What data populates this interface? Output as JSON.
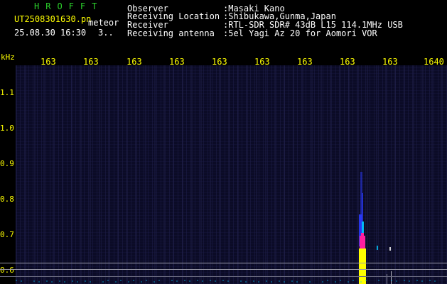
{
  "header": {
    "code": "HROFFT",
    "filename": "UT2508301630.pn",
    "type": "meteor",
    "timestamp": "25.08.30 16:30",
    "count": "3.."
  },
  "info": [
    {
      "label": "Observer",
      "value": ":Masaki Kano"
    },
    {
      "label": "Receiving Location",
      "value": ":Shibukawa,Gunma,Japan"
    },
    {
      "label": "Receiver",
      "value": ":RTL-SDR SDR# 43dB L15 114.1MHz USB"
    },
    {
      "label": "Receiving antenna",
      "value": ":5el Yagi Az 20 for Aomori VOR"
    }
  ],
  "axes": {
    "y_unit": "kHz",
    "x_ticks": [
      "163",
      "163",
      "163",
      "163",
      "163",
      "163",
      "163",
      "163",
      "163",
      "1640"
    ],
    "y_ticks": [
      "1.1",
      "1.0",
      "0.9",
      "0.8",
      "0.7",
      "0.6"
    ]
  },
  "colors": {
    "background": "#000000",
    "plot_noise": "#0b0b26",
    "text_yellow": "#ffff00",
    "text_green": "#2bd12b",
    "echo_yellow": "#ffff00",
    "echo_magenta": "#ff1fa0",
    "echo_cyan": "#00c8ff",
    "echo_blue": "#2a3aff"
  }
}
